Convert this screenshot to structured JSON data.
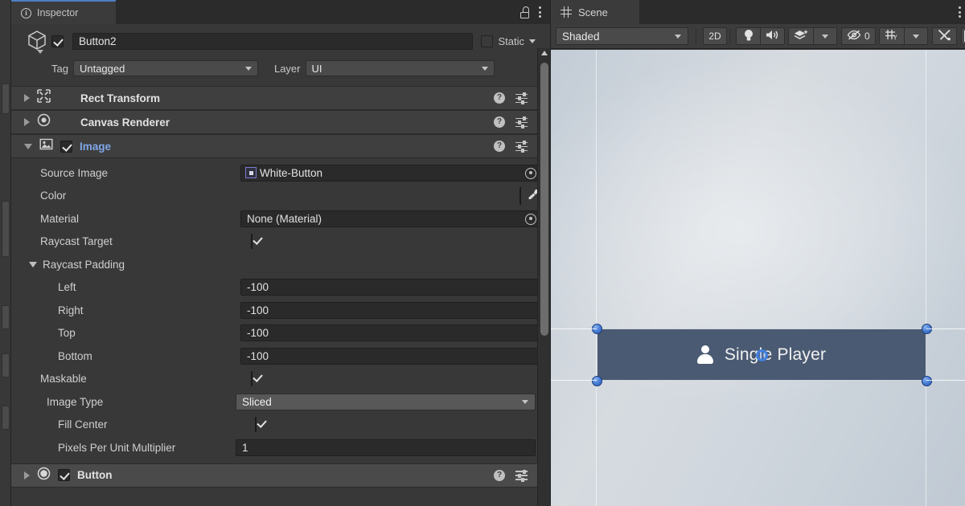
{
  "inspector": {
    "tab_label": "Inspector",
    "tab_icon": "info-icon",
    "lock_icon": "lock-open-icon",
    "menu_icon": "kebab-menu-icon",
    "object": {
      "enabled": true,
      "name": "Button2",
      "static_label": "Static",
      "static_checked": false,
      "tag_label": "Tag",
      "tag_value": "Untagged",
      "layer_label": "Layer",
      "layer_value": "UI"
    },
    "components": [
      {
        "title": "Rect Transform",
        "icon": "rect-transform-icon",
        "expanded": false,
        "has_toggle": false,
        "accent": false
      },
      {
        "title": "Canvas Renderer",
        "icon": "canvas-renderer-icon",
        "expanded": false,
        "has_toggle": false,
        "accent": false
      },
      {
        "title": "Image",
        "icon": "image-component-icon",
        "expanded": true,
        "has_toggle": true,
        "enabled": true,
        "accent": true
      },
      {
        "title": "Button",
        "icon": "button-component-icon",
        "expanded": false,
        "has_toggle": true,
        "enabled": true,
        "accent": false
      }
    ],
    "image_props": {
      "source_image_label": "Source Image",
      "source_image_value": "White-Button",
      "color_label": "Color",
      "color_value": "#4A5A72",
      "color_alpha": "#FFFFFF",
      "material_label": "Material",
      "material_value": "None (Material)",
      "raycast_target_label": "Raycast Target",
      "raycast_target_checked": true,
      "raycast_padding_label": "Raycast Padding",
      "padding": [
        {
          "label": "Left",
          "value": "-100"
        },
        {
          "label": "Right",
          "value": "-100"
        },
        {
          "label": "Top",
          "value": "-100"
        },
        {
          "label": "Bottom",
          "value": "-100"
        }
      ],
      "maskable_label": "Maskable",
      "maskable_checked": true,
      "image_type_label": "Image Type",
      "image_type_value": "Sliced",
      "fill_center_label": "Fill Center",
      "fill_center_checked": true,
      "ppum_label": "Pixels Per Unit Multiplier",
      "ppum_value": "1"
    },
    "row_icons": {
      "help": "help-icon",
      "preset": "preset-settings-icon",
      "menu": "kebab-menu-icon"
    }
  },
  "scene": {
    "tab_label": "Scene",
    "tab_icon": "grid-icon",
    "menu_icon": "kebab-menu-icon",
    "toolbar": {
      "draw_mode": "Shaded",
      "two_d_label": "2D",
      "lighting_icon": "lightbulb-icon",
      "audio_icon": "speaker-icon",
      "fx_icon": "effects-layers-icon",
      "fx_caret_icon": "chevron-down-icon",
      "hidden_icon": "eye-off-icon",
      "hidden_count": "0",
      "grid_icon": "grid-axis-icon",
      "grid_caret_icon": "chevron-down-icon",
      "gizmos_icon": "tools-icon"
    },
    "button_object": {
      "label": "Single Player",
      "icon": "person-icon",
      "fill_color": "#4A5A72",
      "selected": true,
      "handles": 4,
      "pivot_icon": "pivot-handle-icon"
    }
  },
  "colors": {
    "accent_blue": "#4D7FC4",
    "panel_bg": "#383838",
    "header_bg": "#3F3F3F",
    "field_bg": "#2A2A2A",
    "scene_bg": "#D2D7DD"
  }
}
